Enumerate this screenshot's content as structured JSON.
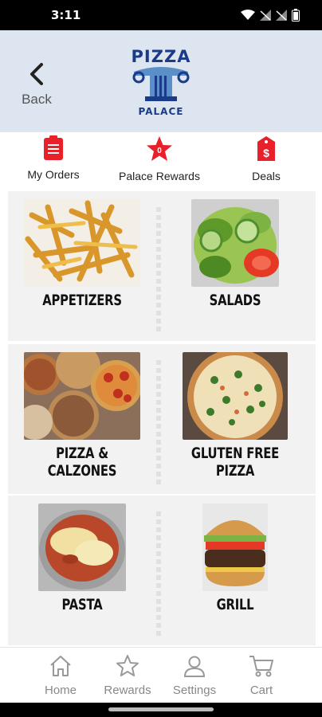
{
  "status": {
    "time": "3:11"
  },
  "header": {
    "back_label": "Back",
    "logo_line1": "PIZZA",
    "logo_line2": "PALACE"
  },
  "quick_actions": [
    {
      "label": "My Orders",
      "icon": "clipboard-icon"
    },
    {
      "label": "Palace Rewards",
      "icon": "star-badge-icon",
      "badge": "0"
    },
    {
      "label": "Deals",
      "icon": "price-tag-icon"
    }
  ],
  "categories": [
    {
      "label": "APPETIZERS"
    },
    {
      "label": "SALADS"
    },
    {
      "label": "PIZZA & CALZONES"
    },
    {
      "label": "GLUTEN FREE PIZZA"
    },
    {
      "label": "PASTA"
    },
    {
      "label": "GRILL"
    }
  ],
  "bottom_nav": [
    {
      "label": "Home",
      "icon": "home-icon"
    },
    {
      "label": "Rewards",
      "icon": "star-icon"
    },
    {
      "label": "Settings",
      "icon": "user-icon"
    },
    {
      "label": "Cart",
      "icon": "cart-icon"
    }
  ],
  "colors": {
    "accent_red": "#e8202a",
    "header_bg": "#dde6f0",
    "logo_blue": "#1a3a8a"
  }
}
